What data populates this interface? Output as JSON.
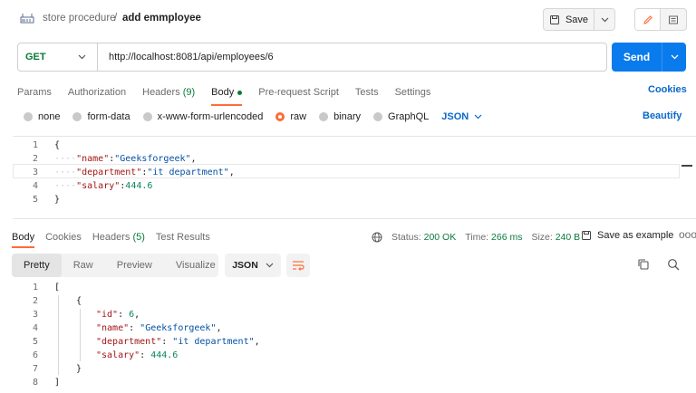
{
  "breadcrumb": {
    "parent": "store procedure",
    "separator": "/",
    "current": "add emmployee"
  },
  "toolbar": {
    "save_label": "Save"
  },
  "request": {
    "method": "GET",
    "url": "http://localhost:8081/api/employees/6",
    "send_label": "Send",
    "tabs": [
      {
        "label": "Params"
      },
      {
        "label": "Authorization"
      },
      {
        "label": "Headers",
        "count": "(9)"
      },
      {
        "label": "Body"
      },
      {
        "label": "Pre-request Script"
      },
      {
        "label": "Tests"
      },
      {
        "label": "Settings"
      }
    ],
    "cookies_label": "Cookies",
    "body_types": [
      "none",
      "form-data",
      "x-www-form-urlencoded",
      "raw",
      "binary",
      "GraphQL"
    ],
    "body_type_selected": "raw",
    "format": "JSON",
    "beautify_label": "Beautify",
    "body_lines": [
      {
        "n": "1",
        "text": "{"
      },
      {
        "n": "2",
        "key": "\"name\"",
        "val": "\"Geeksforgeek\"",
        "tail": ","
      },
      {
        "n": "3",
        "key": "\"department\"",
        "val": "\"it department\"",
        "tail": ","
      },
      {
        "n": "4",
        "key": "\"salary\"",
        "num": "444.6"
      },
      {
        "n": "5",
        "text": "}"
      }
    ]
  },
  "response": {
    "tabs": [
      {
        "label": "Body"
      },
      {
        "label": "Cookies"
      },
      {
        "label": "Headers",
        "count": "(5)"
      },
      {
        "label": "Test Results"
      }
    ],
    "status_label": "Status:",
    "status_value": "200 OK",
    "time_label": "Time:",
    "time_value": "266 ms",
    "size_label": "Size:",
    "size_value": "240 B",
    "save_example_label": "Save as example",
    "more_label": "ooo",
    "views": [
      "Pretty",
      "Raw",
      "Preview",
      "Visualize"
    ],
    "format": "JSON",
    "body_lines": [
      {
        "n": "1",
        "text": "["
      },
      {
        "n": "2",
        "text": "{"
      },
      {
        "n": "3",
        "key": "\"id\"",
        "num": "6",
        "tail": ","
      },
      {
        "n": "4",
        "key": "\"name\"",
        "val": "\"Geeksforgeek\"",
        "tail": ","
      },
      {
        "n": "5",
        "key": "\"department\"",
        "val": "\"it department\"",
        "tail": ","
      },
      {
        "n": "6",
        "key": "\"salary\"",
        "num": "444.6"
      },
      {
        "n": "7",
        "text": "}"
      },
      {
        "n": "8",
        "text": "]"
      }
    ]
  },
  "colors": {
    "accent": "#ff6c37",
    "send": "#097bed",
    "link": "#0a68c9",
    "get": "#0c7a3a"
  }
}
